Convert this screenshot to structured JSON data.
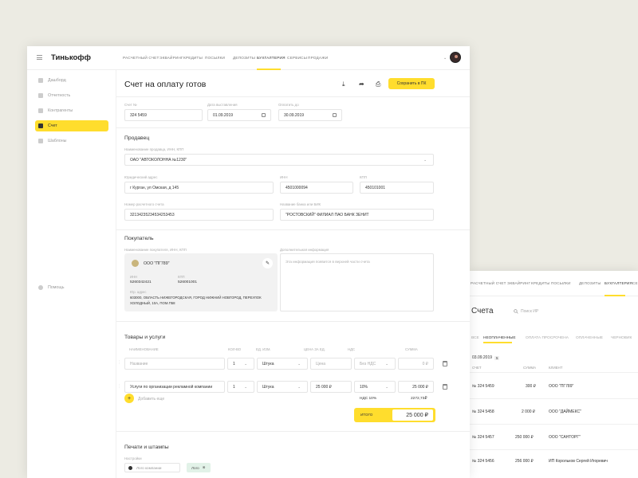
{
  "app": {
    "logo": "Тинькофф",
    "nav": [
      "РАСЧЕТНЫЙ СЧЕТ",
      "ЭКВАЙРИНГ",
      "КРЕДИТЫ",
      "ПОСЫЛКИ",
      "ДЕПОЗИТЫ",
      "БУХГАЛТЕРИЯ",
      "СЕРВИСЫ",
      "ПРОДАЖИ"
    ],
    "nav_active": "БУХГАЛТЕРИЯ"
  },
  "sidebar": {
    "items": [
      "Дашборд",
      "Отчетность",
      "Контрагенты",
      "Счет",
      "Шаблоны"
    ],
    "active": "Счет",
    "help": "Помощь"
  },
  "invoice": {
    "title": "Счет на оплату готов",
    "save_label": "Сохранить в ПК",
    "number_label": "Счет №",
    "number": "324 5459",
    "issue_date_label": "Дата выставления",
    "issue_date": "01.09.2019",
    "due_date_label": "Оплатить до",
    "due_date": "30.09.2019"
  },
  "seller": {
    "section": "Продавец",
    "name_label": "Наименование продавца, ИНН, КПП",
    "name": "ОАО \"АВТОКОЛОННА №1230\"",
    "address_label": "Юридический адрес",
    "address": "г Курган, ул Омская, д 145",
    "inn_label": "ИНН",
    "inn": "4501000094",
    "kpp_label": "КПП",
    "kpp": "450101001",
    "account_label": "Номер расчетного счета",
    "account": "32134235234534253453",
    "bank_label": "Название банка или БИК",
    "bank": "\"РОСТОВСКИЙ\" ФИЛИАЛ ПАО БАНК ЗЕНИТ"
  },
  "buyer": {
    "section": "Покупатель",
    "name_label": "Наименование покупателя, ИНН, КПП",
    "name": "ООО \"ПГ789\"",
    "inn_label": "ИНН",
    "inn": "5260342421",
    "kpp_label": "КПП",
    "kpp": "526001001",
    "address_label": "Юр. адрес",
    "address_line1": "603000, ОБЛАСТЬ НИЖЕГОРОДСКАЯ, ГОРОД НИЖНИЙ НОВГОРОД, ПЕРЕУЛОК",
    "address_line2": "ХОЛОДНЫЙ, 10А, ПОМ.П58",
    "extra_label": "Дополнительная информация",
    "extra_placeholder": "Эта информация появится в верхней части счета"
  },
  "goods": {
    "section": "Товары и услуги",
    "headers": [
      "НАИМЕНОВАНИЕ",
      "КОЛ-ВО",
      "ЕД. ИЗМ.",
      "ЦЕНА ЗА ЕД.",
      "НДС",
      "СУММА"
    ],
    "row1": {
      "name": "Название",
      "qty": "1",
      "unit": "Штука",
      "price": "Цена",
      "vat": "Без НДС",
      "sum": "0 ₽"
    },
    "row2": {
      "name": "Услуги по организации рекламной компании",
      "qty": "1",
      "unit": "Штука",
      "price": "25 000 ₽",
      "vat": "10%",
      "sum": "25 000 ₽"
    },
    "add_label": "Добавить еще",
    "vat_label": "НДС 10%",
    "vat_value": "2272,73₽",
    "total_label": "ИТОГО",
    "total_value": "25 000 ₽"
  },
  "stamps": {
    "section": "Печати и штампы",
    "label": "Настройки",
    "toggle": "Лого компании",
    "chip": "Лого"
  },
  "accounts": {
    "nav": [
      "РАСЧЕТНЫЙ СЧЕТ",
      "ЭКВАЙРИНГ",
      "КРЕДИТЫ",
      "ПОСЫЛКИ",
      "ДЕПОЗИТЫ",
      "БУХГАЛТЕРИЯ",
      "СЕ"
    ],
    "title": "Счета",
    "search_placeholder": "Поиск ИР",
    "tabs": [
      "ВСЕ",
      "НЕОПЛАЧЕННЫЕ",
      "ОПЛАТА ПРОСРОЧЕНА",
      "ОПЛАЧЕННЫЕ",
      "ЧЕРНОВИК"
    ],
    "date": "03.09.2019",
    "date_badge": "5",
    "headers": [
      "СЧЕТ",
      "СУММА",
      "КЛИЕНТ"
    ],
    "rows": [
      {
        "num": "№ 324 5459",
        "sum": "300 ₽",
        "client": "ООО \"ПГ789\""
      },
      {
        "num": "№ 324 5458",
        "sum": "2 000 ₽",
        "client": "ООО \"ДАЙМЕКС\""
      },
      {
        "num": "№ 324 5457",
        "sum": "250 000 ₽",
        "client": "ООО \"САНТОРГ\""
      },
      {
        "num": "№ 324 5456",
        "sum": "256 000 ₽",
        "client": "ИП Корольков Сергей Игоревич"
      }
    ]
  }
}
